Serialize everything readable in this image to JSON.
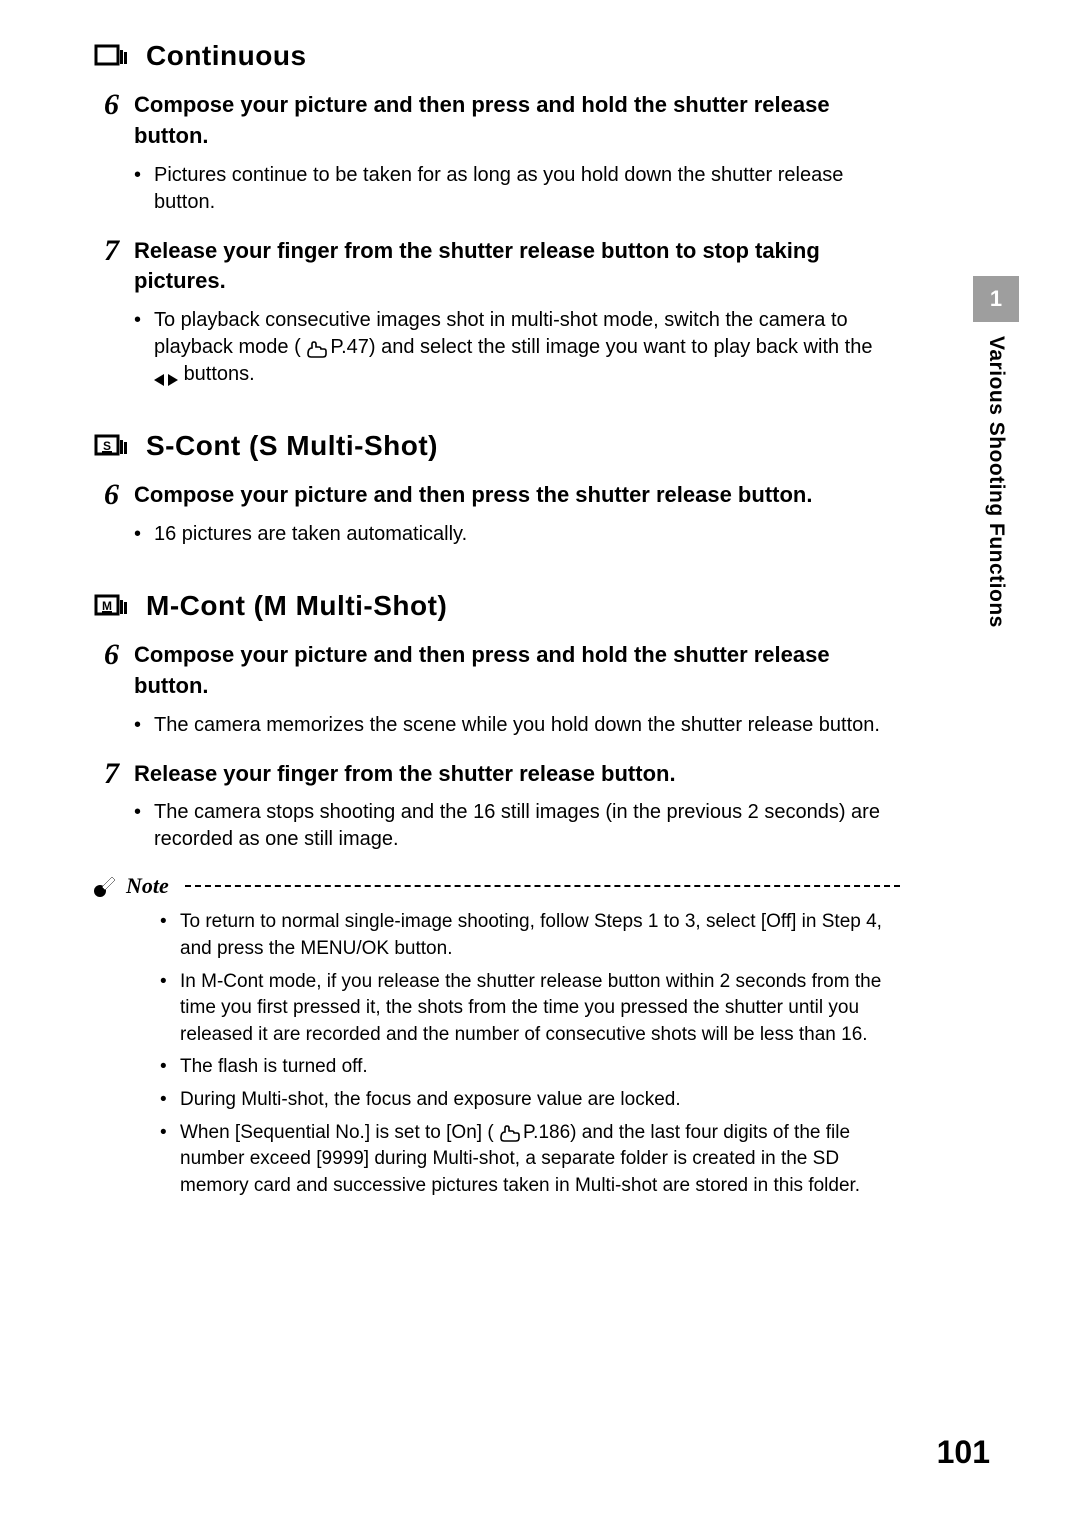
{
  "sidebar": {
    "chapter_number": "1",
    "chapter_title": "Various Shooting Functions"
  },
  "page_number": "101",
  "sections": [
    {
      "icon": "continuous",
      "title": "Continuous",
      "steps": [
        {
          "num": "6",
          "title": "Compose your picture and then press and hold the shutter release button.",
          "bullets": [
            {
              "text": "Pictures continue to be taken for as long as you hold down the shutter release button."
            }
          ]
        },
        {
          "num": "7",
          "title": "Release your finger from the shutter release button to stop taking pictures.",
          "bullets": [
            {
              "html": "playback_ref"
            }
          ]
        }
      ]
    },
    {
      "icon": "s-mode",
      "title": "S-Cont (S Multi-Shot)",
      "steps": [
        {
          "num": "6",
          "title": "Compose your picture and then press the shutter release button.",
          "bullets": [
            {
              "text": "16 pictures are taken automatically."
            }
          ]
        }
      ]
    },
    {
      "icon": "m-mode",
      "title": "M-Cont (M Multi-Shot)",
      "steps": [
        {
          "num": "6",
          "title": "Compose your picture and then press and hold the shutter release button.",
          "bullets": [
            {
              "text": "The camera memorizes the scene while you hold down the shutter release button."
            }
          ]
        },
        {
          "num": "7",
          "title": "Release your finger from the shutter release button.",
          "bullets": [
            {
              "text": "The camera stops shooting and the 16 still images (in the previous 2 seconds) are recorded as one still image."
            }
          ]
        }
      ]
    }
  ],
  "note_label": "Note",
  "notes": [
    "To return to normal single-image shooting, follow Steps 1 to 3, select [Off] in Step 4, and press the MENU/OK button.",
    "In M-Cont mode, if you release the shutter release button within 2 seconds from the time you first pressed it, the shots from the time you pressed the shutter until you released it are recorded and the number of consecutive shots will be less than 16.",
    "The flash is turned off.",
    "During Multi-shot, the focus and exposure value are locked."
  ],
  "note_seq_prefix": "When [Sequential No.] is set to [On] (",
  "note_seq_ref": "P.186",
  "note_seq_suffix": ") and the last four digits of the file number exceed [9999] during Multi-shot, a separate folder is created in the SD memory card and successive pictures taken in Multi-shot are stored in this folder.",
  "playback_prefix": "To playback consecutive images shot in multi-shot mode, switch the camera to playback mode (",
  "playback_ref": "P.47",
  "playback_mid": ") and select the still image you want to play back with the ",
  "playback_suffix": " buttons."
}
